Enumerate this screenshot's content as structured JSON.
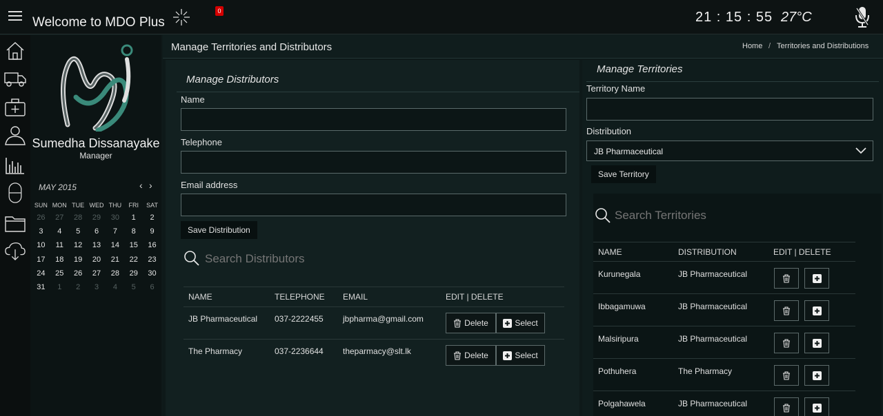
{
  "header": {
    "app_title": "Welcome to MDO Plus",
    "notification_count": "0",
    "time": "21 : 15 : 55",
    "temperature": "27°C"
  },
  "profile": {
    "name": "Sumedha Dissanayake",
    "role": "Manager"
  },
  "calendar": {
    "month_label": "MAY 2015",
    "prev": "‹",
    "next": "›",
    "weekdays": [
      "SUN",
      "MON",
      "TUE",
      "WED",
      "THU",
      "FRI",
      "SAT"
    ],
    "weeks": [
      [
        [
          "26",
          true
        ],
        [
          "27",
          true
        ],
        [
          "28",
          true
        ],
        [
          "29",
          true
        ],
        [
          "30",
          true
        ],
        [
          "1",
          false
        ],
        [
          "2",
          false
        ]
      ],
      [
        [
          "3",
          false
        ],
        [
          "4",
          false
        ],
        [
          "5",
          false
        ],
        [
          "6",
          false
        ],
        [
          "7",
          false
        ],
        [
          "8",
          false
        ],
        [
          "9",
          false
        ]
      ],
      [
        [
          "10",
          false
        ],
        [
          "11",
          false
        ],
        [
          "12",
          false
        ],
        [
          "13",
          false
        ],
        [
          "14",
          false
        ],
        [
          "15",
          false
        ],
        [
          "16",
          false
        ]
      ],
      [
        [
          "17",
          false
        ],
        [
          "18",
          false
        ],
        [
          "19",
          false
        ],
        [
          "20",
          false
        ],
        [
          "21",
          false
        ],
        [
          "22",
          false
        ],
        [
          "23",
          false
        ]
      ],
      [
        [
          "24",
          false
        ],
        [
          "25",
          false
        ],
        [
          "26",
          false
        ],
        [
          "27",
          false
        ],
        [
          "28",
          false
        ],
        [
          "29",
          false
        ],
        [
          "30",
          false
        ]
      ],
      [
        [
          "31",
          false
        ],
        [
          "1",
          true
        ],
        [
          "2",
          true
        ],
        [
          "3",
          true
        ],
        [
          "4",
          true
        ],
        [
          "5",
          true
        ],
        [
          "6",
          true
        ]
      ]
    ]
  },
  "page": {
    "title": "Manage Territories and Distributors",
    "breadcrumb_home": "Home",
    "breadcrumb_sep": "/",
    "breadcrumb_current": "Territories and Distributions"
  },
  "distributors": {
    "section_title": "Manage Distributors",
    "name_label": "Name",
    "name_value": "",
    "telephone_label": "Telephone",
    "telephone_value": "",
    "email_label": "Email address",
    "email_value": "",
    "save_label": "Save Distribution",
    "search_placeholder": "Search Distributors",
    "columns": [
      "NAME",
      "TELEPHONE",
      "EMAIL",
      "EDIT | DELETE"
    ],
    "delete_label": "Delete",
    "select_label": "Select",
    "rows": [
      {
        "name": "JB Pharmaceutical",
        "telephone": "037-2222455",
        "email": "jbpharma@gmail.com"
      },
      {
        "name": "The Pharmacy",
        "telephone": "037-2236644",
        "email": "theparmacy@slt.lk"
      }
    ]
  },
  "territories": {
    "section_title": "Manage Territories",
    "name_label": "Territory Name",
    "name_value": "",
    "distribution_label": "Distribution",
    "distribution_selected": "JB Pharmaceutical",
    "save_label": "Save Territory",
    "search_placeholder": "Search Territories",
    "columns": [
      "NAME",
      "DISTRIBUTION",
      "EDIT | DELETE"
    ],
    "rows": [
      {
        "name": "Kurunegala",
        "distribution": "JB Pharmaceutical"
      },
      {
        "name": "Ibbagamuwa",
        "distribution": "JB Pharmaceutical"
      },
      {
        "name": "Malsiripura",
        "distribution": "JB Pharmaceutical"
      },
      {
        "name": "Pothuhera",
        "distribution": "The Pharmacy"
      },
      {
        "name": "Polgahawela",
        "distribution": "JB Pharmaceutical"
      }
    ]
  },
  "icons": {
    "menu": "hamburger-icon",
    "compass": "compass-icon",
    "mic": "microphone-icon",
    "rail": [
      "home-icon",
      "truck-icon",
      "medical-kit-icon",
      "user-icon",
      "bar-chart-icon",
      "pill-icon",
      "folder-icon",
      "cloud-download-icon"
    ]
  }
}
